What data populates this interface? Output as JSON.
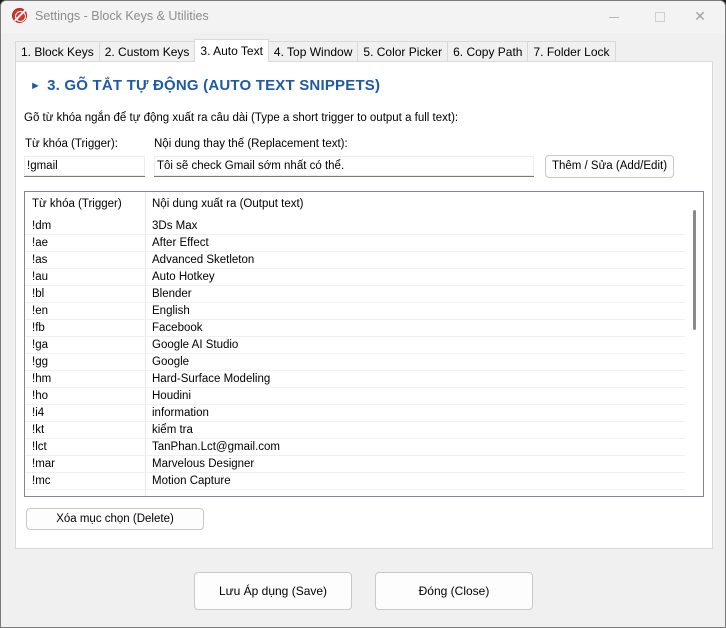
{
  "window": {
    "title": "Settings - Block Keys & Utilities"
  },
  "tabs": [
    {
      "label": "1. Block Keys"
    },
    {
      "label": "2. Custom Keys"
    },
    {
      "label": "3. Auto Text"
    },
    {
      "label": "4. Top Window"
    },
    {
      "label": "5. Color Picker"
    },
    {
      "label": "6. Copy Path"
    },
    {
      "label": "7. Folder Lock"
    }
  ],
  "active_tab": "3. Auto Text",
  "panel": {
    "heading_arrow": "►",
    "heading": "3. GÕ TẮT TỰ ĐỘNG (AUTO TEXT SNIPPETS)",
    "description": "Gõ từ khóa ngắn để tự động xuất ra câu dài (Type a short trigger to output a full text):",
    "trigger_label": "Từ khóa (Trigger):",
    "replacement_label": "Nội dung thay thế (Replacement text):",
    "trigger_value": "!gmail",
    "replacement_value": "Tôi sẽ check Gmail sớm nhất có thể.",
    "add_button": "Thêm / Sửa (Add/Edit)",
    "delete_button": "Xóa mục chọn (Delete)"
  },
  "list": {
    "columns": [
      "Từ khóa (Trigger)",
      "Nội dung xuất ra (Output text)"
    ],
    "rows": [
      [
        "!dm",
        "3Ds Max"
      ],
      [
        "!ae",
        "After Effect"
      ],
      [
        "!as",
        "Advanced Sketleton"
      ],
      [
        "!au",
        "Auto Hotkey"
      ],
      [
        "!bl",
        "Blender"
      ],
      [
        "!en",
        "English"
      ],
      [
        "!fb",
        "Facebook"
      ],
      [
        "!ga",
        "Google AI Studio"
      ],
      [
        "!gg",
        "Google"
      ],
      [
        "!hm",
        "Hard-Surface Modeling"
      ],
      [
        "!ho",
        "Houdini"
      ],
      [
        "!i4",
        "information"
      ],
      [
        "!kt",
        "kiểm tra"
      ],
      [
        "!lct",
        "TanPhan.Lct@gmail.com"
      ],
      [
        "!mar",
        "Marvelous Designer"
      ],
      [
        "!mc",
        "Motion Capture"
      ]
    ]
  },
  "footer": {
    "save_button": "Lưu  Áp dụng (Save)",
    "close_button": "Đóng (Close)"
  },
  "colors": {
    "heading": "#1f5aa6",
    "app_icon": "#d4342b"
  }
}
